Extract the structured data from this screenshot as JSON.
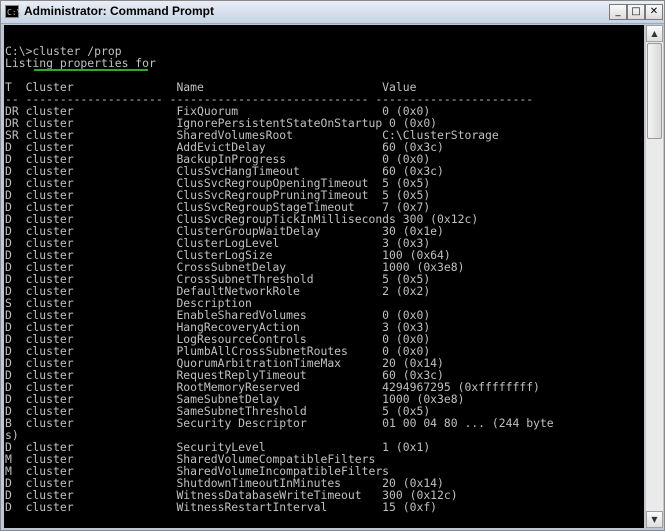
{
  "window": {
    "title": "Administrator: Command Prompt",
    "icon_label": "C:\\",
    "controls": {
      "minimize": "_",
      "maximize": "□",
      "close": "✕"
    }
  },
  "console": {
    "lines": [
      "",
      "C:\\>cluster /prop",
      "Listing properties for",
      "",
      "T  Cluster               Name                          Value",
      "-- -------------------- ----------------------------- -----------------------",
      "DR cluster               FixQuorum                     0 (0x0)",
      "DR cluster               IgnorePersistentStateOnStartup 0 (0x0)",
      "SR cluster               SharedVolumesRoot             C:\\ClusterStorage",
      "D  cluster               AddEvictDelay                 60 (0x3c)",
      "D  cluster               BackupInProgress              0 (0x0)",
      "D  cluster               ClusSvcHangTimeout            60 (0x3c)",
      "D  cluster               ClusSvcRegroupOpeningTimeout  5 (0x5)",
      "D  cluster               ClusSvcRegroupPruningTimeout  5 (0x5)",
      "D  cluster               ClusSvcRegroupStageTimeout    7 (0x7)",
      "D  cluster               ClusSvcRegroupTickInMilliseconds 300 (0x12c)",
      "D  cluster               ClusterGroupWaitDelay         30 (0x1e)",
      "D  cluster               ClusterLogLevel               3 (0x3)",
      "D  cluster               ClusterLogSize                100 (0x64)",
      "D  cluster               CrossSubnetDelay              1000 (0x3e8)",
      "D  cluster               CrossSubnetThreshold          5 (0x5)",
      "D  cluster               DefaultNetworkRole            2 (0x2)",
      "S  cluster               Description",
      "D  cluster               EnableSharedVolumes           0 (0x0)",
      "D  cluster               HangRecoveryAction            3 (0x3)",
      "D  cluster               LogResourceControls           0 (0x0)",
      "D  cluster               PlumbAllCrossSubnetRoutes     0 (0x0)",
      "D  cluster               QuorumArbitrationTimeMax      20 (0x14)",
      "D  cluster               RequestReplyTimeout           60 (0x3c)",
      "D  cluster               RootMemoryReserved            4294967295 (0xffffffff)",
      "D  cluster               SameSubnetDelay               1000 (0x3e8)",
      "D  cluster               SameSubnetThreshold           5 (0x5)",
      "B  cluster               Security Descriptor           01 00 04 80 ... (244 byte",
      "s)",
      "D  cluster               SecurityLevel                 1 (0x1)",
      "M  cluster               SharedVolumeCompatibleFilters",
      "M  cluster               SharedVolumeIncompatibleFilters",
      "D  cluster               ShutdownTimeoutInMinutes      20 (0x14)",
      "D  cluster               WitnessDatabaseWriteTimeout   300 (0x12c)",
      "D  cluster               WitnessRestartInterval        15 (0xf)"
    ]
  },
  "scrollbar": {
    "up_arrow": "▲",
    "down_arrow": "▼"
  },
  "colors": {
    "console_background": "#000000",
    "console_text": "#c0c0c0",
    "annotation_underline": "#2fa82f"
  }
}
